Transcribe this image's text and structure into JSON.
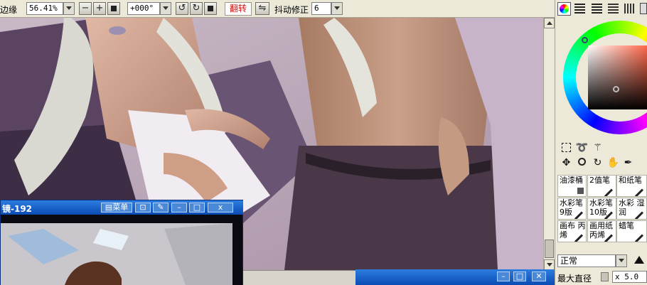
{
  "toolbar": {
    "edge_label": "边缘",
    "zoom_value": "56.41%",
    "minus_label": "−",
    "plus_label": "+",
    "rotation_value": "+000°",
    "flip_label": "翻转",
    "stabilizer_label": "抖动修正",
    "stabilizer_value": "6"
  },
  "navigator": {
    "title": "镜-192",
    "menu_label": "菜单",
    "close_label": "x"
  },
  "panel": {
    "brushes": [
      {
        "label": "油漆桶"
      },
      {
        "label": "2值笔"
      },
      {
        "label": "和纸笔"
      },
      {
        "label": "水彩笔 9版"
      },
      {
        "label": "水彩笔 10版"
      },
      {
        "label": "水彩 湿润"
      },
      {
        "label": "画布 丙烯"
      },
      {
        "label": "画用纸 丙烯"
      },
      {
        "label": "蜡笔"
      }
    ],
    "blend_mode": "正常",
    "max_size_label": "最大直径",
    "max_size_value": "x 5.0"
  },
  "colors": {
    "accent_red": "#d01010",
    "titlebar_blue": "#0a4cb4"
  }
}
